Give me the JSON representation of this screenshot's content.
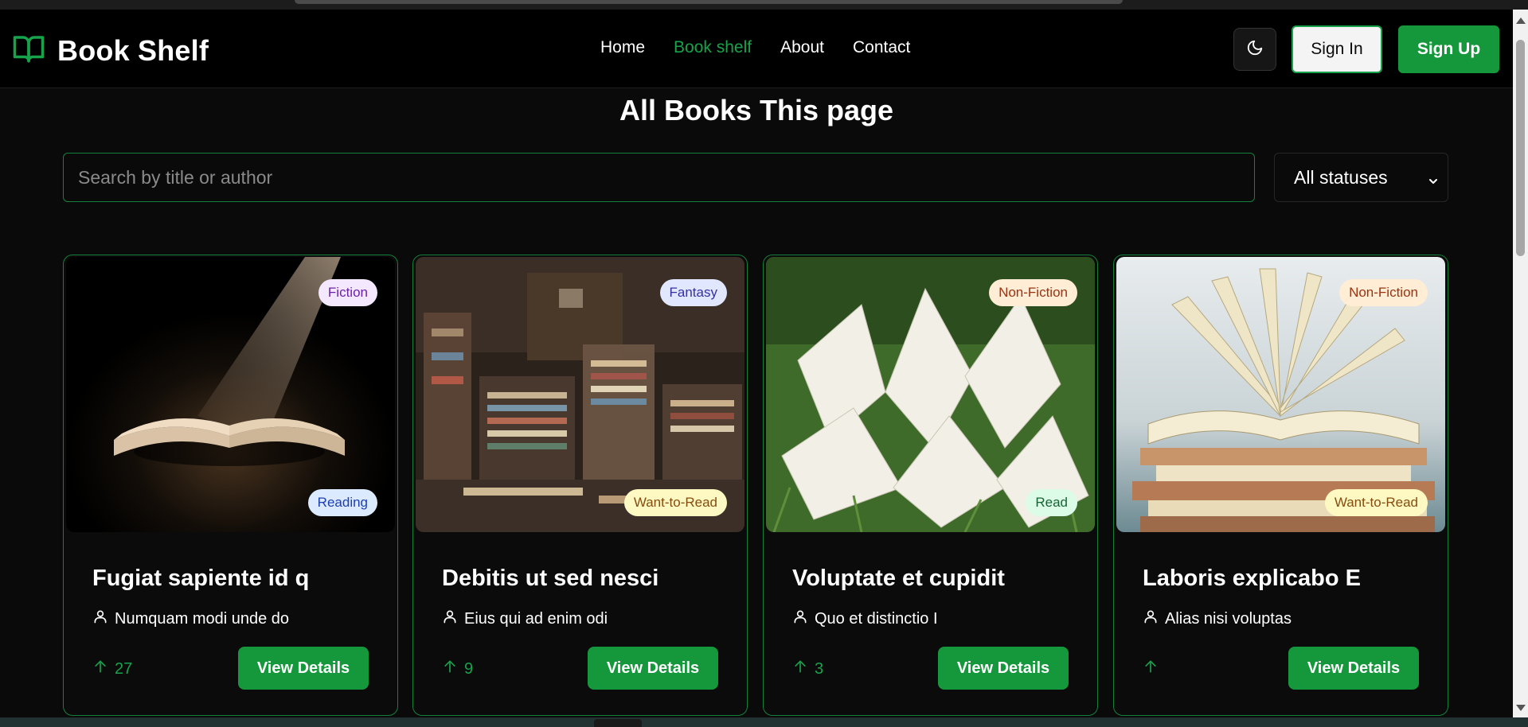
{
  "brand": {
    "name": "Book Shelf"
  },
  "nav": [
    {
      "label": "Home",
      "active": false
    },
    {
      "label": "Book shelf",
      "active": true
    },
    {
      "label": "About",
      "active": false
    },
    {
      "label": "Contact",
      "active": false
    }
  ],
  "auth": {
    "sign_in": "Sign In",
    "sign_up": "Sign Up"
  },
  "page": {
    "title": "All Books This page"
  },
  "filters": {
    "search_placeholder": "Search by title or author",
    "status_value": "All statuses"
  },
  "colors": {
    "accent": "#16a34a",
    "button": "#15983b",
    "background": "#0a0a0a"
  },
  "books": [
    {
      "genre": "Fiction",
      "status": "Reading",
      "title": "Fugiat sapiente id q",
      "author": "Numquam modi unde do",
      "votes": "27",
      "button": "View Details"
    },
    {
      "genre": "Fantasy",
      "status": "Want-to-Read",
      "title": "Debitis ut sed nesci",
      "author": "Eius qui ad enim odi",
      "votes": "9",
      "button": "View Details"
    },
    {
      "genre": "Non-Fiction",
      "status": "Read",
      "title": "Voluptate et cupidit",
      "author": "Quo et distinctio I",
      "votes": "3",
      "button": "View Details"
    },
    {
      "genre": "Non-Fiction",
      "status": "Want-to-Read",
      "title": "Laboris explicabo E",
      "author": "Alias nisi voluptas",
      "votes": "",
      "button": "View Details"
    }
  ]
}
